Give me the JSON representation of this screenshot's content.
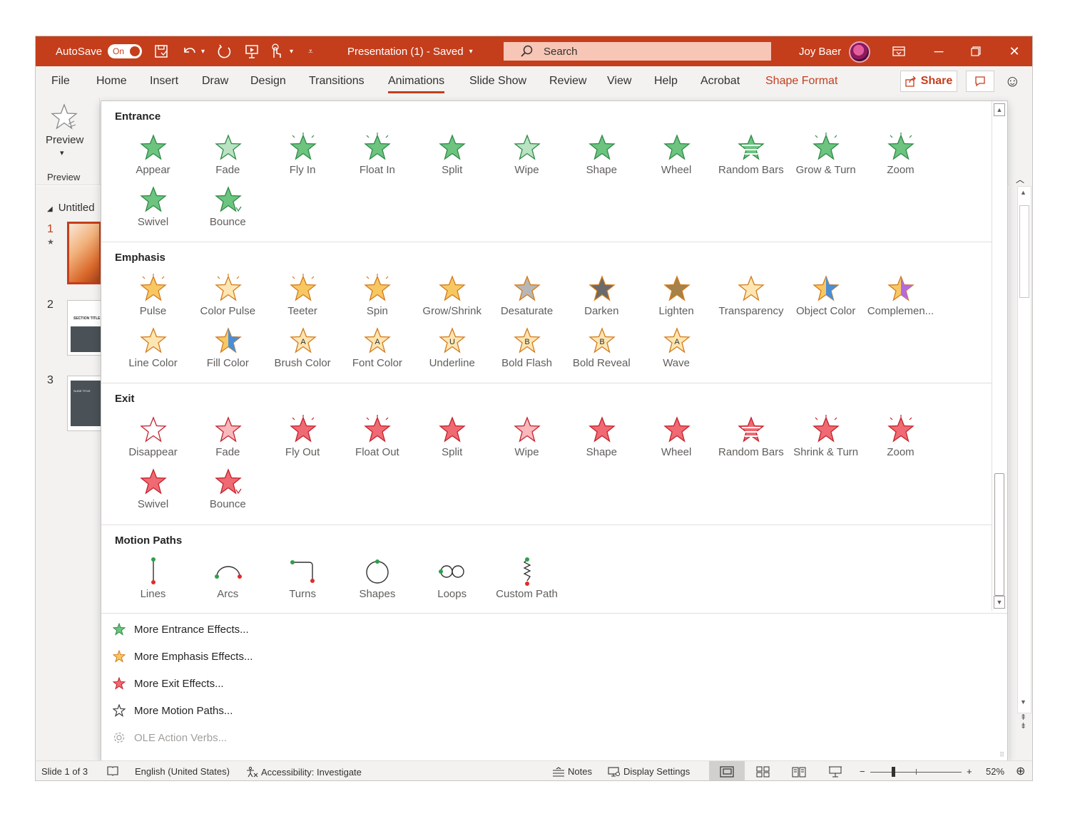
{
  "titlebar": {
    "autosave_label": "AutoSave",
    "autosave_state": "On",
    "document_title": "Presentation (1)  -  Saved",
    "search_placeholder": "Search",
    "user_name": "Joy Baer",
    "accent_color": "#c43e1c"
  },
  "tabs": [
    "File",
    "Home",
    "Insert",
    "Draw",
    "Design",
    "Transitions",
    "Animations",
    "Slide Show",
    "Review",
    "View",
    "Help",
    "Acrobat",
    "Shape Format"
  ],
  "active_tab": "Animations",
  "share_label": "Share",
  "ribbon": {
    "preview_label": "Preview",
    "preview_group_label": "Preview"
  },
  "slides_pane": {
    "section_label": "Untitled",
    "slide_numbers": [
      "1",
      "2",
      "3"
    ],
    "thumb_text": [
      "SECTION TITLE",
      "SLIDE TITLE"
    ]
  },
  "gallery": {
    "entrance": {
      "title": "Entrance",
      "items": [
        "Appear",
        "Fade",
        "Fly In",
        "Float In",
        "Split",
        "Wipe",
        "Shape",
        "Wheel",
        "Random Bars",
        "Grow & Turn",
        "Zoom",
        "Swivel",
        "Bounce"
      ]
    },
    "emphasis": {
      "title": "Emphasis",
      "items": [
        "Pulse",
        "Color Pulse",
        "Teeter",
        "Spin",
        "Grow/Shrink",
        "Desaturate",
        "Darken",
        "Lighten",
        "Transparency",
        "Object Color",
        "Complemen...",
        "Line Color",
        "Fill Color",
        "Brush Color",
        "Font Color",
        "Underline",
        "Bold Flash",
        "Bold Reveal",
        "Wave"
      ]
    },
    "exit": {
      "title": "Exit",
      "items": [
        "Disappear",
        "Fade",
        "Fly Out",
        "Float Out",
        "Split",
        "Wipe",
        "Shape",
        "Wheel",
        "Random Bars",
        "Shrink & Turn",
        "Zoom",
        "Swivel",
        "Bounce"
      ]
    },
    "motion_paths": {
      "title": "Motion Paths",
      "items": [
        "Lines",
        "Arcs",
        "Turns",
        "Shapes",
        "Loops",
        "Custom Path"
      ]
    },
    "more": [
      {
        "label": "More Entrance Effects...",
        "enabled": true
      },
      {
        "label": "More Emphasis Effects...",
        "enabled": true
      },
      {
        "label": "More Exit Effects...",
        "enabled": true
      },
      {
        "label": "More Motion Paths...",
        "enabled": true
      },
      {
        "label": "OLE Action Verbs...",
        "enabled": false
      }
    ],
    "colors": {
      "entrance": "#3fae5a",
      "emphasis": "#f5b64a",
      "exit": "#e8414b",
      "path_start": "#2e9e4f",
      "path_end": "#e32b2b"
    }
  },
  "status": {
    "slide_indicator": "Slide 1 of 3",
    "language": "English (United States)",
    "accessibility": "Accessibility: Investigate",
    "notes": "Notes",
    "display_settings": "Display Settings",
    "zoom": "52%"
  }
}
